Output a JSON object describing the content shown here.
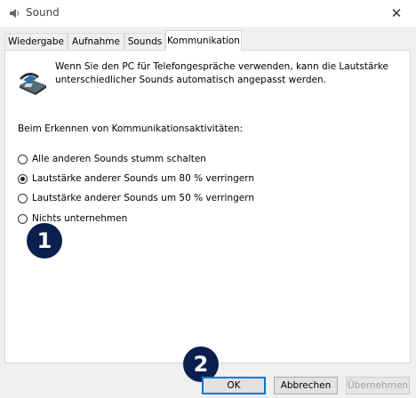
{
  "window": {
    "title": "Sound",
    "close_glyph": "✕"
  },
  "tabs": [
    {
      "label": "Wiedergabe",
      "active": false
    },
    {
      "label": "Aufnahme",
      "active": false
    },
    {
      "label": "Sounds",
      "active": false
    },
    {
      "label": "Kommunikation",
      "active": true
    }
  ],
  "panel": {
    "intro": "Wenn Sie den PC für Telefongespräche verwenden, kann die Lautstärke unterschiedlicher Sounds automatisch angepasst werden.",
    "section_label": "Beim Erkennen von Kommunikationsaktivitäten:",
    "options": [
      {
        "label": "Alle anderen Sounds stumm schalten",
        "selected": false
      },
      {
        "label": "Lautstärke anderer Sounds um 80 % verringern",
        "selected": true
      },
      {
        "label": "Lautstärke anderer Sounds um 50 % verringern",
        "selected": false
      },
      {
        "label": "Nichts unternehmen",
        "selected": false
      }
    ]
  },
  "annotations": {
    "badge1": "1",
    "badge2": "2",
    "badge_color": "#0b1f4e"
  },
  "buttons": {
    "ok": "OK",
    "cancel": "Abbrechen",
    "apply": "Übernehmen"
  },
  "icons": {
    "title": "speaker-icon",
    "panel": "telephone-icon"
  }
}
